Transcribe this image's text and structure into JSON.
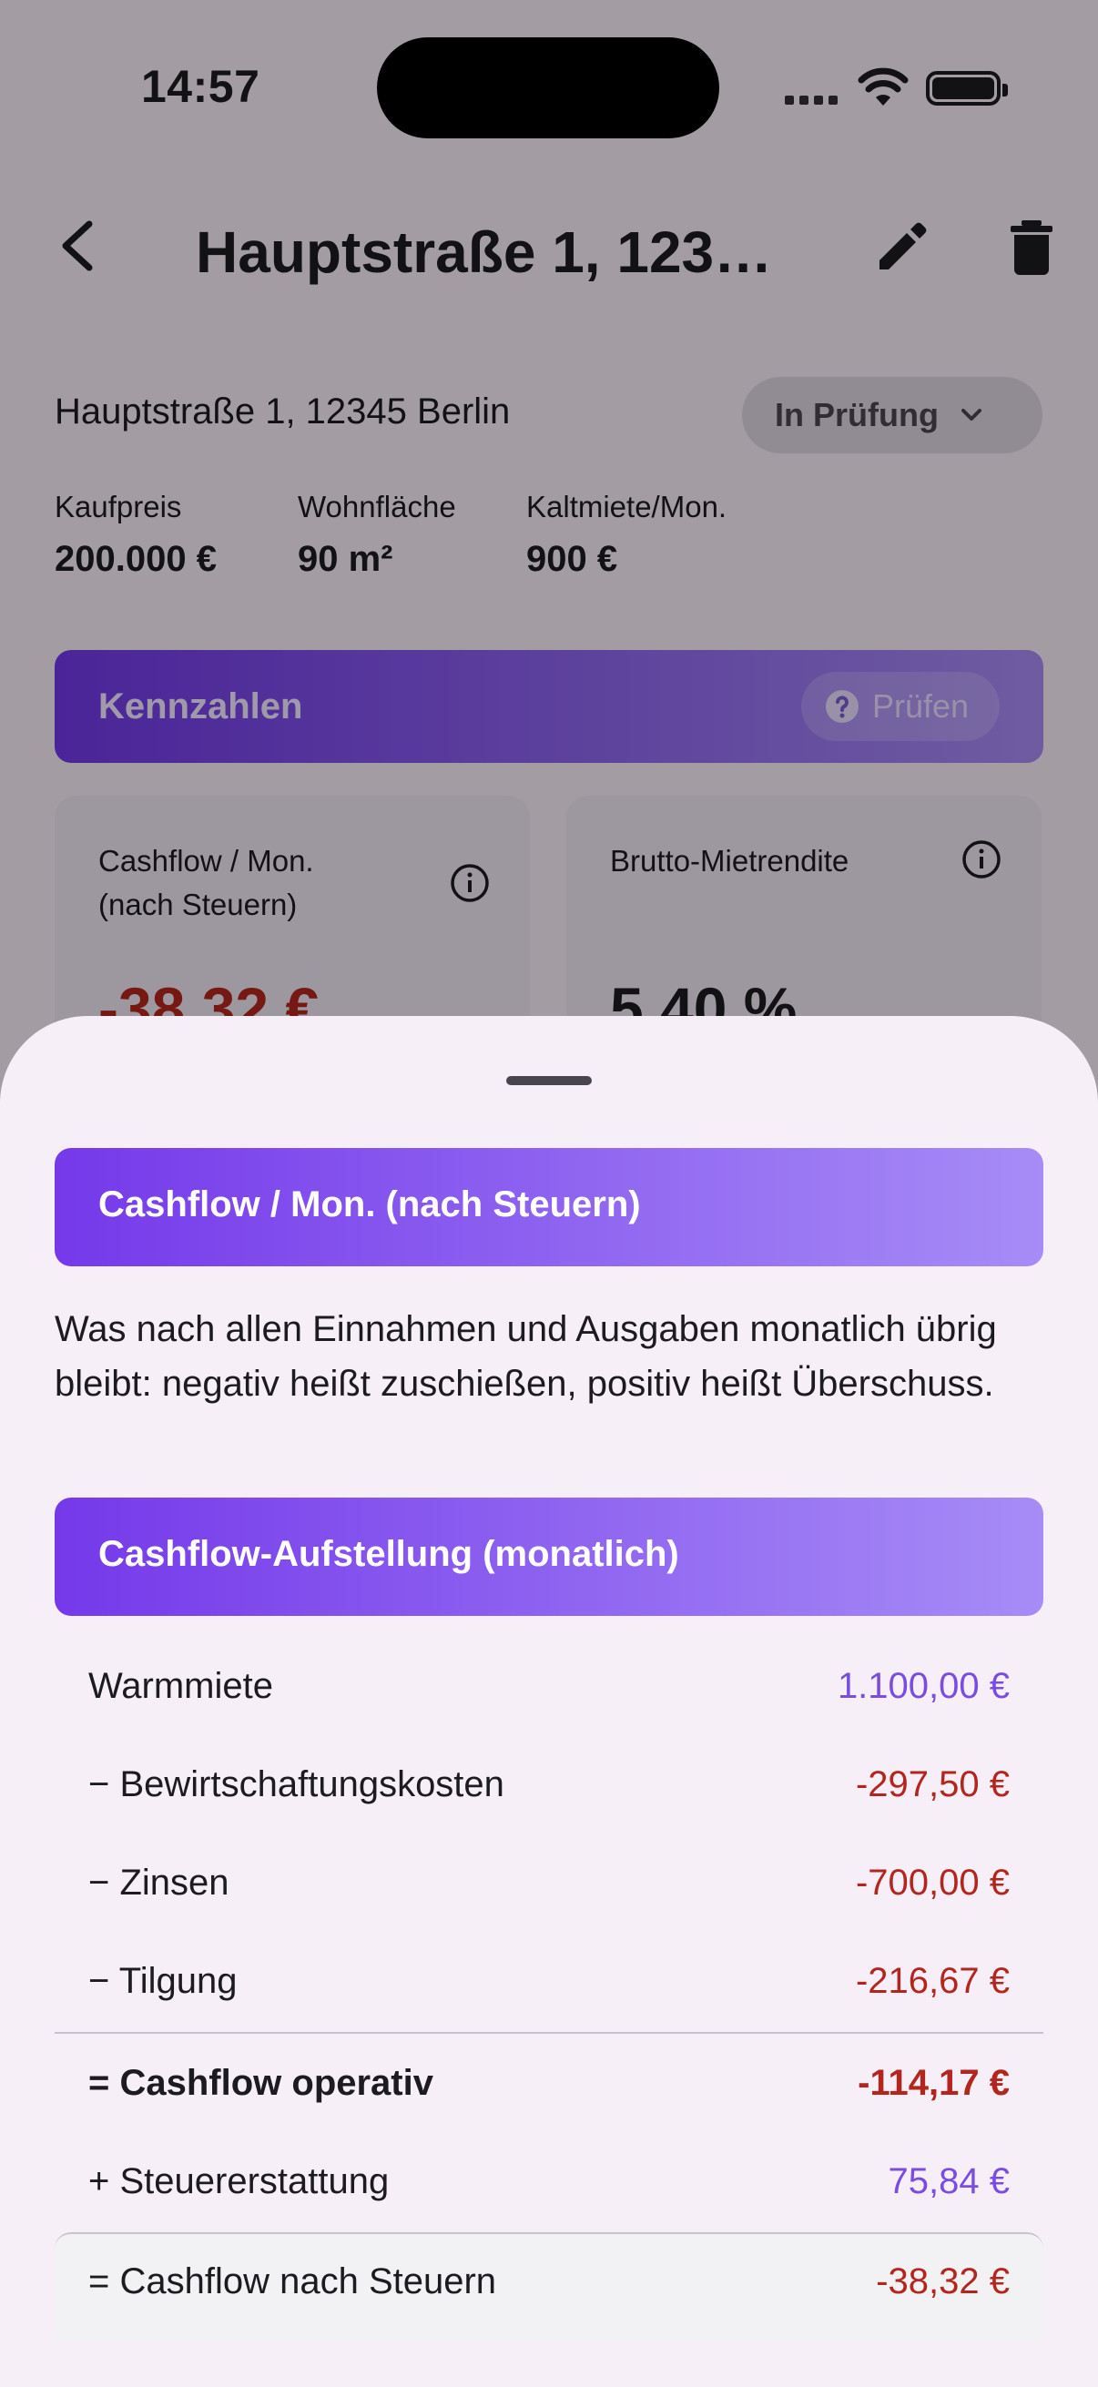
{
  "status_bar": {
    "time": "14:57"
  },
  "app_bar": {
    "title": "Hauptstraße 1, 123…"
  },
  "property": {
    "address": "Hauptstraße 1, 12345 Berlin",
    "status": "In Prüfung",
    "facts": [
      {
        "label": "Kaufpreis",
        "value": "200.000 €"
      },
      {
        "label": "Wohnfläche",
        "value": "90 m²"
      },
      {
        "label": "Kaltmiete/Mon.",
        "value": "900 €"
      }
    ]
  },
  "kennzahlen": {
    "title": "Kennzahlen",
    "check_button": "Prüfen",
    "cards": [
      {
        "label": "Cashflow / Mon.\n(nach Steuern)",
        "value": "-38,32 €",
        "color": "#b3261e"
      },
      {
        "label": "Brutto-Mietrendite",
        "value": "5,40 %",
        "color": "#1c1b1f"
      }
    ]
  },
  "sheet": {
    "title": "Cashflow / Mon. (nach Steuern)",
    "description": "Was nach allen Einnahmen und Ausgaben monatlich übrig bleibt: negativ heißt zuschießen, positiv heißt Überschuss.",
    "breakdown_title": "Cashflow-Aufstellung (monatlich)",
    "rows": [
      {
        "label": "Warmmiete",
        "value": "1.100,00 €"
      },
      {
        "label": "− Bewirtschaftungskosten",
        "value": "-297,50 €"
      },
      {
        "label": "− Zinsen",
        "value": "-700,00 €"
      },
      {
        "label": "− Tilgung",
        "value": "-216,67 €"
      },
      {
        "label": "= Cashflow operativ",
        "value": "-114,17 €"
      },
      {
        "label": "+ Steuererstattung",
        "value": "75,84 €"
      },
      {
        "label": "= Cashflow nach Steuern",
        "value": "-38,32 €"
      }
    ]
  },
  "colors": {
    "accent": "#7539ea",
    "negative": "#b3261e",
    "positive": "#7a4ce0"
  }
}
